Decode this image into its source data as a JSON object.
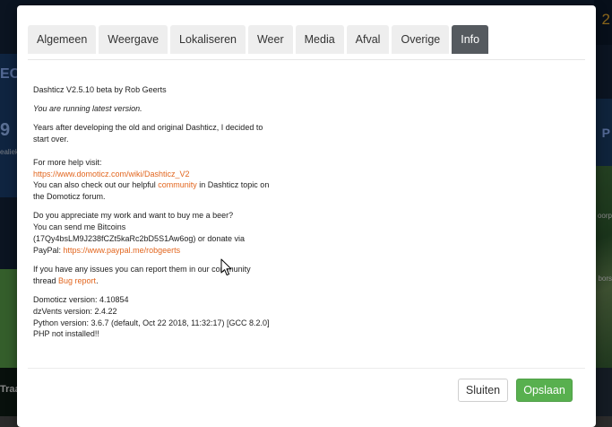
{
  "background": {
    "left_fragments": [
      "EC",
      "9",
      "ealiek",
      "Traa"
    ],
    "right_fragments": [
      "2",
      "P",
      "oorp",
      "bors"
    ]
  },
  "tabs": [
    {
      "label": "Algemeen",
      "active": false
    },
    {
      "label": "Weergave",
      "active": false
    },
    {
      "label": "Lokaliseren",
      "active": false
    },
    {
      "label": "Weer",
      "active": false
    },
    {
      "label": "Media",
      "active": false
    },
    {
      "label": "Afval",
      "active": false
    },
    {
      "label": "Overige",
      "active": false
    },
    {
      "label": "Info",
      "active": true
    }
  ],
  "info": {
    "version_line": "Dashticz V2.5.10 beta by Rob Geerts",
    "latest_notice": "You are running latest version.",
    "history": "Years after developing the old and original Dashticz, I decided to start over.",
    "help_intro": "For more help visit:",
    "help_link": "https://www.domoticz.com/wiki/Dashticz_V2",
    "community_pre": "You can also check out our helpful ",
    "community_link": "community",
    "community_post": " in Dashticz topic on the Domoticz forum.",
    "beer_question": "Do you appreciate my work and want to buy me a beer?",
    "bitcoin_text": "You can send me Bitcoins (17Qy4bsLM9J238fCZt5kaRc2bD5S1Aw6og) or donate via PayPal: ",
    "paypal_link": "https://www.paypal.me/robgeerts",
    "issues_pre": "If you have any issues you can report them in our community thread ",
    "issues_link": "Bug report",
    "issues_post": ".",
    "domoticz_version": "Domoticz version: 4.10854",
    "dzvents_version": "dzVents version: 2.4.22",
    "python_version": "Python version: 3.6.7 (default, Oct 22 2018, 11:32:17) [GCC 8.2.0]",
    "php_status": "PHP not installed!!"
  },
  "footer": {
    "close_label": "Sluiten",
    "save_label": "Opslaan"
  },
  "colors": {
    "link": "#e2661f",
    "active_tab": "#555a5f",
    "save_button": "#58b04f"
  }
}
